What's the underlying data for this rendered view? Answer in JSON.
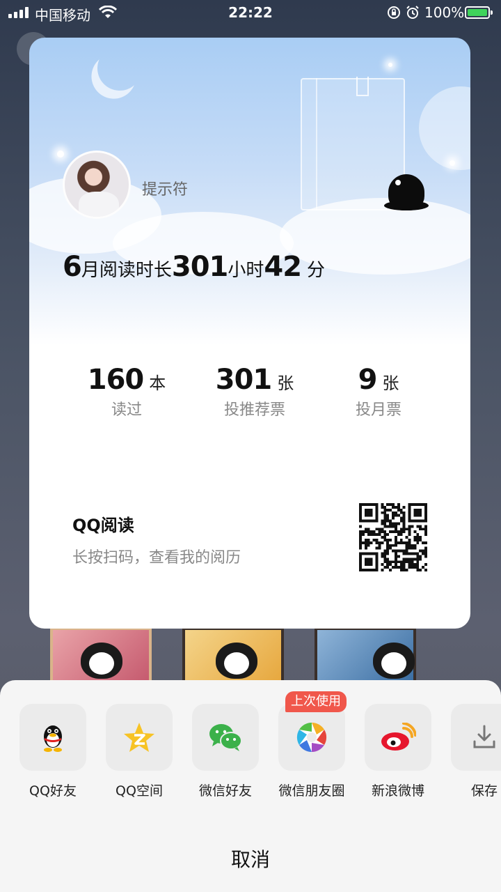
{
  "status_bar": {
    "carrier": "中国移动",
    "time": "22:22",
    "battery": "100%"
  },
  "card": {
    "username": "提示符",
    "reading_time": {
      "month": "6",
      "prefix": "月阅读时长",
      "hours": "301",
      "hours_unit": "小时",
      "minutes": "42",
      "minutes_unit": "分"
    },
    "stats": [
      {
        "value": "160",
        "unit": "本",
        "label": "读过"
      },
      {
        "value": "301",
        "unit": "张",
        "label": "投推荐票"
      },
      {
        "value": "9",
        "unit": "张",
        "label": "投月票"
      }
    ],
    "brand": "QQ阅读",
    "hint": "长按扫码，查看我的阅历"
  },
  "share": {
    "items": [
      {
        "label": "QQ好友",
        "icon": "qq-penguin-icon"
      },
      {
        "label": "QQ空间",
        "icon": "qzone-star-icon"
      },
      {
        "label": "微信好友",
        "icon": "wechat-icon"
      },
      {
        "label": "微信朋友圈",
        "icon": "moments-aperture-icon"
      },
      {
        "label": "新浪微博",
        "icon": "weibo-icon"
      },
      {
        "label": "保存",
        "icon": "download-icon"
      }
    ],
    "badge": "上次使用",
    "cancel": "取消"
  }
}
